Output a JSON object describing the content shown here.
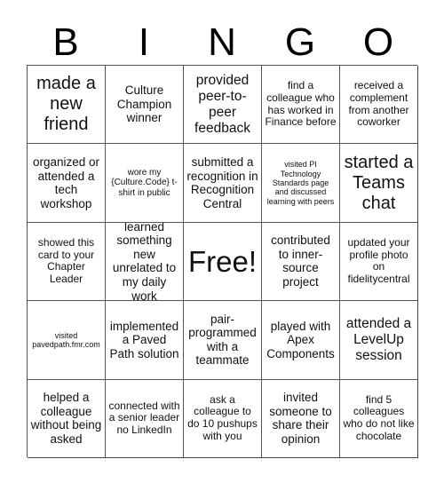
{
  "header": {
    "letters": [
      "B",
      "I",
      "N",
      "G",
      "O"
    ]
  },
  "board": {
    "rows": [
      [
        {
          "text": "made a new friend",
          "size": "xl"
        },
        {
          "text": "Culture Champion winner",
          "size": "md"
        },
        {
          "text": "provided peer-to-peer feedback",
          "size": "lg"
        },
        {
          "text": "find a colleague who has worked in Finance before",
          "size": "sm"
        },
        {
          "text": "received a complement from another coworker",
          "size": "sm"
        }
      ],
      [
        {
          "text": "organized or attended a tech workshop",
          "size": "md"
        },
        {
          "text": "wore my {Culture.Code} t-shirt in public",
          "size": "xs"
        },
        {
          "text": "submitted a recognition in Recognition Central",
          "size": "md"
        },
        {
          "text": "visited PI Technology Standards page and discussed learning with peers",
          "size": "xxs"
        },
        {
          "text": "started a Teams chat",
          "size": "xl"
        }
      ],
      [
        {
          "text": "showed this card to your Chapter Leader",
          "size": "sm"
        },
        {
          "text": "learned something new unrelated to my daily work",
          "size": "md"
        },
        {
          "text": "Free!",
          "size": "free"
        },
        {
          "text": "contributed to inner-source project",
          "size": "md"
        },
        {
          "text": "updated your profile photo on fidelitycentral",
          "size": "sm"
        }
      ],
      [
        {
          "text": "visited pavedpath.fmr.com",
          "size": "xxs"
        },
        {
          "text": "implemented a Paved Path solution",
          "size": "md"
        },
        {
          "text": "pair-programmed with a teammate",
          "size": "md"
        },
        {
          "text": "played with Apex Components",
          "size": "md"
        },
        {
          "text": "attended a LevelUp session",
          "size": "lg"
        }
      ],
      [
        {
          "text": "helped a colleague without being asked",
          "size": "md"
        },
        {
          "text": "connected with a senior leader no LinkedIn",
          "size": "sm"
        },
        {
          "text": "ask a colleague to do 10 pushups with you",
          "size": "sm"
        },
        {
          "text": "invited someone to share their opinion",
          "size": "md"
        },
        {
          "text": "find 5 colleagues who do not like chocolate",
          "size": "sm"
        }
      ]
    ]
  }
}
